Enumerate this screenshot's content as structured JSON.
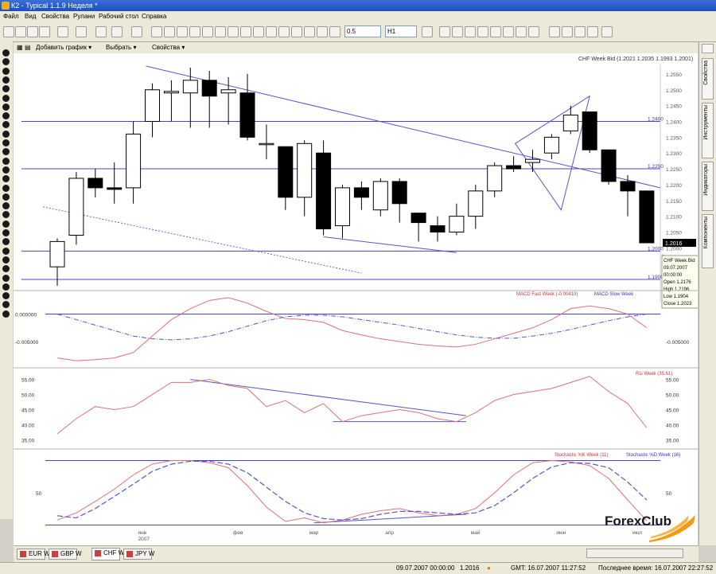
{
  "window": {
    "title": "К2 - Typical 1.1.9 Неделя *"
  },
  "menu": [
    "Файл",
    "Вид",
    "Свойства",
    "Рулани",
    "Рабочий стол",
    "Справка"
  ],
  "toolbar": {
    "period_select": "0.5",
    "timeframe_select": "Н1"
  },
  "chart_toolbar": {
    "add_chart": "Добавить график ▾",
    "select": "Выбрать ▾",
    "properties": "Свойства ▾"
  },
  "right_tabs": [
    "Свойства",
    "Инструменты",
    "Индикаторы",
    "Компоненты"
  ],
  "bottom_tabs": [
    {
      "label": "EUR W",
      "active": false
    },
    {
      "label": "GBP W",
      "active": false
    },
    {
      "label": "CHF W",
      "active": true
    },
    {
      "label": "JPY W",
      "active": false
    }
  ],
  "status": {
    "datetime": "09.07.2007 00:00:00",
    "price": "1.2016",
    "gmt": "GMT: 16.07.2007 11:27:52",
    "last_time": "Последнее время: 16.07.2007 22:27:52"
  },
  "logo": {
    "text": "ForexClub"
  },
  "chart_data": {
    "type": "candlestick",
    "symbol_label": "CHF Week Bid (1.2021 1.2035 1.1993 1.2001)",
    "price_axis": {
      "ticks": [
        "1.2550",
        "1.2500",
        "1.2450",
        "1.2400",
        "1.2350",
        "1.2300",
        "1.2250",
        "1.2200",
        "1.2150",
        "1.2100",
        "1.2050",
        "1.2000",
        "1.1950",
        "1.1900"
      ],
      "range": [
        1.188,
        1.258
      ]
    },
    "levels": [
      {
        "value": 1.24,
        "label": "1.2400"
      },
      {
        "value": 1.225,
        "label": "1.2250"
      },
      {
        "value": 1.199,
        "label": "1.2000"
      },
      {
        "value": 1.19,
        "label": "1.1900"
      }
    ],
    "current_price": "1.2016",
    "candles": [
      {
        "o": 1.194,
        "h": 1.203,
        "l": 1.188,
        "c": 1.202
      },
      {
        "o": 1.204,
        "h": 1.224,
        "l": 1.201,
        "c": 1.222
      },
      {
        "o": 1.222,
        "h": 1.225,
        "l": 1.216,
        "c": 1.219
      },
      {
        "o": 1.219,
        "h": 1.227,
        "l": 1.214,
        "c": 1.2185
      },
      {
        "o": 1.219,
        "h": 1.24,
        "l": 1.214,
        "c": 1.236
      },
      {
        "o": 1.24,
        "h": 1.252,
        "l": 1.235,
        "c": 1.25
      },
      {
        "o": 1.249,
        "h": 1.253,
        "l": 1.24,
        "c": 1.2495
      },
      {
        "o": 1.249,
        "h": 1.257,
        "l": 1.238,
        "c": 1.253
      },
      {
        "o": 1.253,
        "h": 1.256,
        "l": 1.238,
        "c": 1.248
      },
      {
        "o": 1.249,
        "h": 1.254,
        "l": 1.239,
        "c": 1.25
      },
      {
        "o": 1.249,
        "h": 1.255,
        "l": 1.234,
        "c": 1.235
      },
      {
        "o": 1.233,
        "h": 1.239,
        "l": 1.228,
        "c": 1.233
      },
      {
        "o": 1.232,
        "h": 1.232,
        "l": 1.212,
        "c": 1.216
      },
      {
        "o": 1.216,
        "h": 1.234,
        "l": 1.21,
        "c": 1.233
      },
      {
        "o": 1.23,
        "h": 1.234,
        "l": 1.204,
        "c": 1.206
      },
      {
        "o": 1.207,
        "h": 1.22,
        "l": 1.203,
        "c": 1.219
      },
      {
        "o": 1.219,
        "h": 1.221,
        "l": 1.212,
        "c": 1.216
      },
      {
        "o": 1.212,
        "h": 1.222,
        "l": 1.21,
        "c": 1.221
      },
      {
        "o": 1.221,
        "h": 1.222,
        "l": 1.208,
        "c": 1.214
      },
      {
        "o": 1.211,
        "h": 1.211,
        "l": 1.202,
        "c": 1.208
      },
      {
        "o": 1.207,
        "h": 1.21,
        "l": 1.202,
        "c": 1.205
      },
      {
        "o": 1.205,
        "h": 1.214,
        "l": 1.204,
        "c": 1.21
      },
      {
        "o": 1.21,
        "h": 1.22,
        "l": 1.206,
        "c": 1.218
      },
      {
        "o": 1.218,
        "h": 1.227,
        "l": 1.216,
        "c": 1.226
      },
      {
        "o": 1.226,
        "h": 1.229,
        "l": 1.224,
        "c": 1.225
      },
      {
        "o": 1.227,
        "h": 1.231,
        "l": 1.224,
        "c": 1.228
      },
      {
        "o": 1.23,
        "h": 1.236,
        "l": 1.228,
        "c": 1.235
      },
      {
        "o": 1.237,
        "h": 1.245,
        "l": 1.236,
        "c": 1.242
      },
      {
        "o": 1.243,
        "h": 1.243,
        "l": 1.23,
        "c": 1.231
      },
      {
        "o": 1.231,
        "h": 1.231,
        "l": 1.22,
        "c": 1.221
      },
      {
        "o": 1.221,
        "h": 1.223,
        "l": 1.21,
        "c": 1.218
      },
      {
        "o": 1.218,
        "h": 1.218,
        "l": 1.2016,
        "c": 1.2016
      }
    ],
    "x_labels": [
      {
        "label": "янв",
        "index": 4.5
      },
      {
        "label": "2007",
        "index": 4.5,
        "row": 2
      },
      {
        "label": "фев",
        "index": 9.5
      },
      {
        "label": "мар",
        "index": 13.5
      },
      {
        "label": "апр",
        "index": 17.5
      },
      {
        "label": "май",
        "index": 22
      },
      {
        "label": "июн",
        "index": 26.5
      },
      {
        "label": "июл",
        "index": 30.5
      }
    ],
    "tooltip": [
      "CHF Week Bid",
      "09.07.2007",
      "00:00:00",
      "Open 1.2176",
      "High 1.2196",
      "Low 1.1904",
      "Close 1.2023"
    ],
    "macd": {
      "legend_fast": "MACD Fast Week  (-0.00410)",
      "legend_slow": "MACD Slow Week",
      "ticks": [
        "0.000000",
        "-0.005000"
      ],
      "fast": [
        -0.008,
        -0.0085,
        -0.0083,
        -0.008,
        -0.007,
        -0.004,
        -0.001,
        0.001,
        0.0025,
        0.003,
        0.002,
        0.0005,
        -0.0008,
        -0.001,
        -0.0015,
        -0.003,
        -0.0038,
        -0.0045,
        -0.005,
        -0.0055,
        -0.0058,
        -0.006,
        -0.0055,
        -0.0045,
        -0.0035,
        -0.0025,
        -0.001,
        0.001,
        0.0015,
        0.001,
        0.0,
        -0.0025
      ],
      "slow": [
        0.0,
        -0.001,
        -0.002,
        -0.003,
        -0.004,
        -0.0045,
        -0.0047,
        -0.0045,
        -0.004,
        -0.0032,
        -0.0022,
        -0.0012,
        -0.0005,
        -0.0002,
        -0.0002,
        -0.0005,
        -0.001,
        -0.0015,
        -0.002,
        -0.0026,
        -0.0032,
        -0.0038,
        -0.0042,
        -0.0044,
        -0.0044,
        -0.004,
        -0.0035,
        -0.0028,
        -0.002,
        -0.0012,
        -0.0005,
        0.0
      ],
      "range": [
        -0.0095,
        0.004
      ]
    },
    "rsi": {
      "legend": "Rsi Week  (35.61)",
      "ticks": [
        "55.00",
        "50.00",
        "45.00",
        "40.00",
        "35.00"
      ],
      "values": [
        37,
        42,
        46,
        45,
        46,
        50,
        54,
        54,
        55,
        53,
        52,
        46,
        48,
        44,
        47,
        41,
        43,
        44,
        45,
        44,
        42,
        41,
        44,
        48,
        50,
        51,
        52,
        54,
        56,
        51,
        47,
        39
      ],
      "range": [
        33,
        57
      ]
    },
    "stoch": {
      "legend_k": "Stochastic %K Week  (11)",
      "legend_d": "Stochastic %D Week  (16)",
      "ticks": [
        "50"
      ],
      "k": [
        12,
        22,
        38,
        55,
        75,
        90,
        95,
        95,
        92,
        85,
        60,
        30,
        10,
        15,
        8,
        12,
        20,
        25,
        28,
        22,
        18,
        20,
        28,
        50,
        75,
        92,
        95,
        93,
        88,
        70,
        40,
        11
      ],
      "d": [
        18,
        15,
        28,
        45,
        62,
        80,
        90,
        94,
        94,
        90,
        78,
        58,
        38,
        22,
        14,
        12,
        14,
        20,
        24,
        24,
        22,
        20,
        22,
        32,
        50,
        70,
        86,
        92,
        91,
        85,
        65,
        40
      ],
      "range": [
        0,
        100
      ]
    }
  }
}
